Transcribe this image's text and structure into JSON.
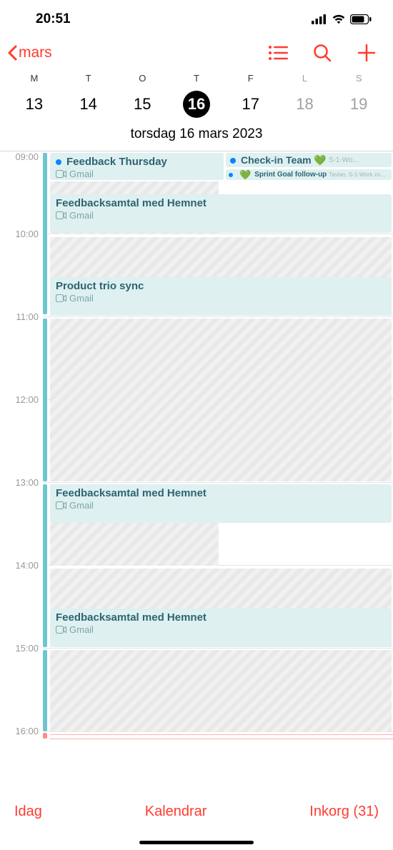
{
  "status": {
    "time": "20:51"
  },
  "nav": {
    "back_label": "mars"
  },
  "week": {
    "days": [
      {
        "dow": "M",
        "num": "13",
        "weekend": false,
        "selected": false
      },
      {
        "dow": "T",
        "num": "14",
        "weekend": false,
        "selected": false
      },
      {
        "dow": "O",
        "num": "15",
        "weekend": false,
        "selected": false
      },
      {
        "dow": "T",
        "num": "16",
        "weekend": false,
        "selected": true
      },
      {
        "dow": "F",
        "num": "17",
        "weekend": false,
        "selected": false
      },
      {
        "dow": "L",
        "num": "18",
        "weekend": true,
        "selected": false
      },
      {
        "dow": "S",
        "num": "19",
        "weekend": true,
        "selected": false
      }
    ],
    "full_date": "torsdag  16 mars 2023"
  },
  "hours": [
    "09:00",
    "10:00",
    "11:00",
    "12:00",
    "13:00",
    "14:00",
    "15:00",
    "16:00"
  ],
  "events": [
    {
      "id": "feedback-thursday",
      "title": "Feedback Thursday",
      "provider": "Gmail",
      "dot": true,
      "video": true
    },
    {
      "id": "checkin-team",
      "title": "Check-in Team 💚",
      "meta": "S-1-Wo…",
      "dot": true
    },
    {
      "id": "sprint-goal",
      "title": "Sprint Goal follow-up",
      "meta": "Tavlan, S-1-Work zo…",
      "dot": true,
      "heart": true
    },
    {
      "id": "feedbacksamtal-1",
      "title": "Feedbacksamtal med Hemnet",
      "provider": "Gmail",
      "video": true
    },
    {
      "id": "product-trio",
      "title": "Product trio sync",
      "provider": "Gmail",
      "video": true
    },
    {
      "id": "feedbacksamtal-2",
      "title": "Feedbacksamtal med Hemnet",
      "provider": "Gmail",
      "video": true
    },
    {
      "id": "feedbacksamtal-3",
      "title": "Feedbacksamtal med Hemnet",
      "provider": "Gmail",
      "video": true
    }
  ],
  "toolbar": {
    "today": "Idag",
    "calendars": "Kalendrar",
    "inbox": "Inkorg (31)"
  }
}
